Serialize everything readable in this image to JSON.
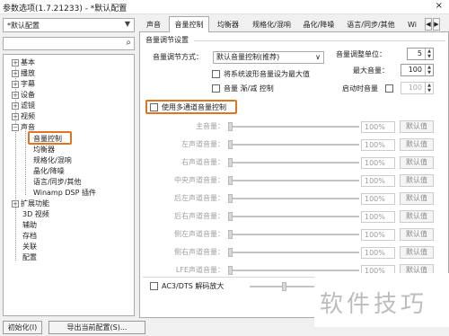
{
  "window": {
    "title": "参数选项(1.7.21233) - *默认配置",
    "close": "×"
  },
  "sidebar": {
    "preset": "*默认配置",
    "tree": [
      "基本",
      "播放",
      "字幕",
      "设备",
      "滤镜",
      "视频",
      "声音",
      "音量控制",
      "均衡器",
      "规格化/混响",
      "晶化/降噪",
      "语言/同步/其他",
      "Winamp DSP 插件",
      "扩展功能",
      "3D 视频",
      "辅助",
      "存档",
      "关联",
      "配置"
    ]
  },
  "tabs": [
    "声音",
    "音量控制",
    "均衡器",
    "规格化/混响",
    "晶化/降噪",
    "语言/同步/其他",
    "Wi"
  ],
  "panel": {
    "group_title": "音量调节设置",
    "mode_label": "音量调节方式：",
    "mode_value": "默认音量控制(推荐)",
    "opt1": "将系统波形音量设为最大值",
    "opt2": "音量 渐/减 控制",
    "unit_label": "音量调整单位：",
    "unit_value": "5",
    "max_label": "最大音量：",
    "max_value": "100",
    "start_label": "启动时音量",
    "start_value": "100",
    "multi_label": "使用多通道音量控制",
    "channels": [
      "主音量：",
      "左声道音量：",
      "右声道音量：",
      "中央声道音量：",
      "后左声道音量：",
      "后右声道音量：",
      "侧左声道音量：",
      "侧右声道音量：",
      "LFE声道音量："
    ],
    "percent": "100%",
    "default_btn": "默认值",
    "ac3_label": "AC3/DTS 解码放大"
  },
  "buttons": {
    "init": "初始化(I)",
    "export": "导出当前配置(S)..."
  },
  "watermark": "软件技巧",
  "colors": {
    "highlight": "#e07422"
  }
}
